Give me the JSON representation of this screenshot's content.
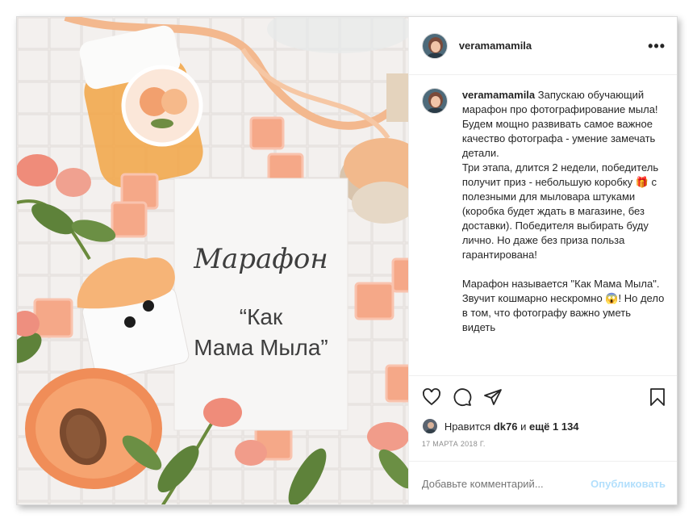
{
  "post": {
    "username": "veramamamila",
    "more_label": "•••",
    "caption": "Запускаю обучающий марафон про фотографирование мыла!\nБудем мощно развивать самое важное качество фотографа - умение замечать детали.\nТри этапа, длится 2 недели, победитель получит приз - небольшую коробку 🎁 с полезными для мыловара штуками (коробка будет ждать в магазине, без доставки). Победителя выбирать буду лично. Но даже без приза польза гарантирована!\n\nМарафон называется \"Как Мама Мыла\". Звучит кошмарно нескромно 😱! Но дело в том, что фотографу важно уметь видеть",
    "likes_prefix": "Нравится",
    "likes_user": "dk76",
    "likes_mid": "и",
    "likes_rest": "ещё 1 134",
    "date": "17 МАРТА 2018 Г.",
    "comment_placeholder": "Добавьте комментарий...",
    "publish_label": "Опубликовать"
  },
  "image": {
    "card_title": "Марафон",
    "card_subtitle_1": "“Как",
    "card_subtitle_2": "Мама Мыла”"
  },
  "colors": {
    "accent_disabled": "#b2dffc",
    "secondary_text": "#8e8e8e",
    "peach": "#f4a876"
  }
}
